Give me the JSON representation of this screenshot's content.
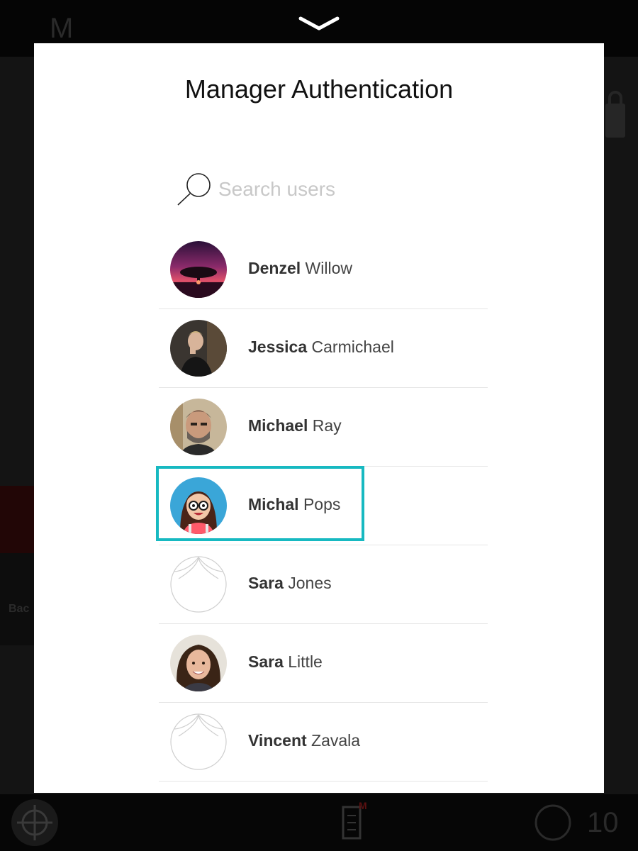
{
  "app": {
    "logo_letter": "M",
    "background_left_label": "Bac",
    "bottom_bar": {
      "notification_badge": "M",
      "count": "10"
    }
  },
  "modal": {
    "title": "Manager Authentication",
    "search": {
      "placeholder": "Search users",
      "value": ""
    },
    "users": [
      {
        "first": "Denzel",
        "last": "Willow",
        "avatar": "sunset-tree-photo"
      },
      {
        "first": "Jessica",
        "last": "Carmichael",
        "avatar": "person-photo"
      },
      {
        "first": "Michael",
        "last": "Ray",
        "avatar": "person-photo"
      },
      {
        "first": "Michal",
        "last": "Pops",
        "avatar": "cartoon-girl-glasses",
        "highlighted": true
      },
      {
        "first": "Sara",
        "last": "Jones",
        "avatar": "default-avatar-outline"
      },
      {
        "first": "Sara",
        "last": "Little",
        "avatar": "person-photo"
      },
      {
        "first": "Vincent",
        "last": "Zavala",
        "avatar": "default-avatar-outline"
      }
    ]
  },
  "colors": {
    "highlight_border": "#17b9c1",
    "modal_background": "#ffffff",
    "backdrop": "#0a0a0a"
  }
}
